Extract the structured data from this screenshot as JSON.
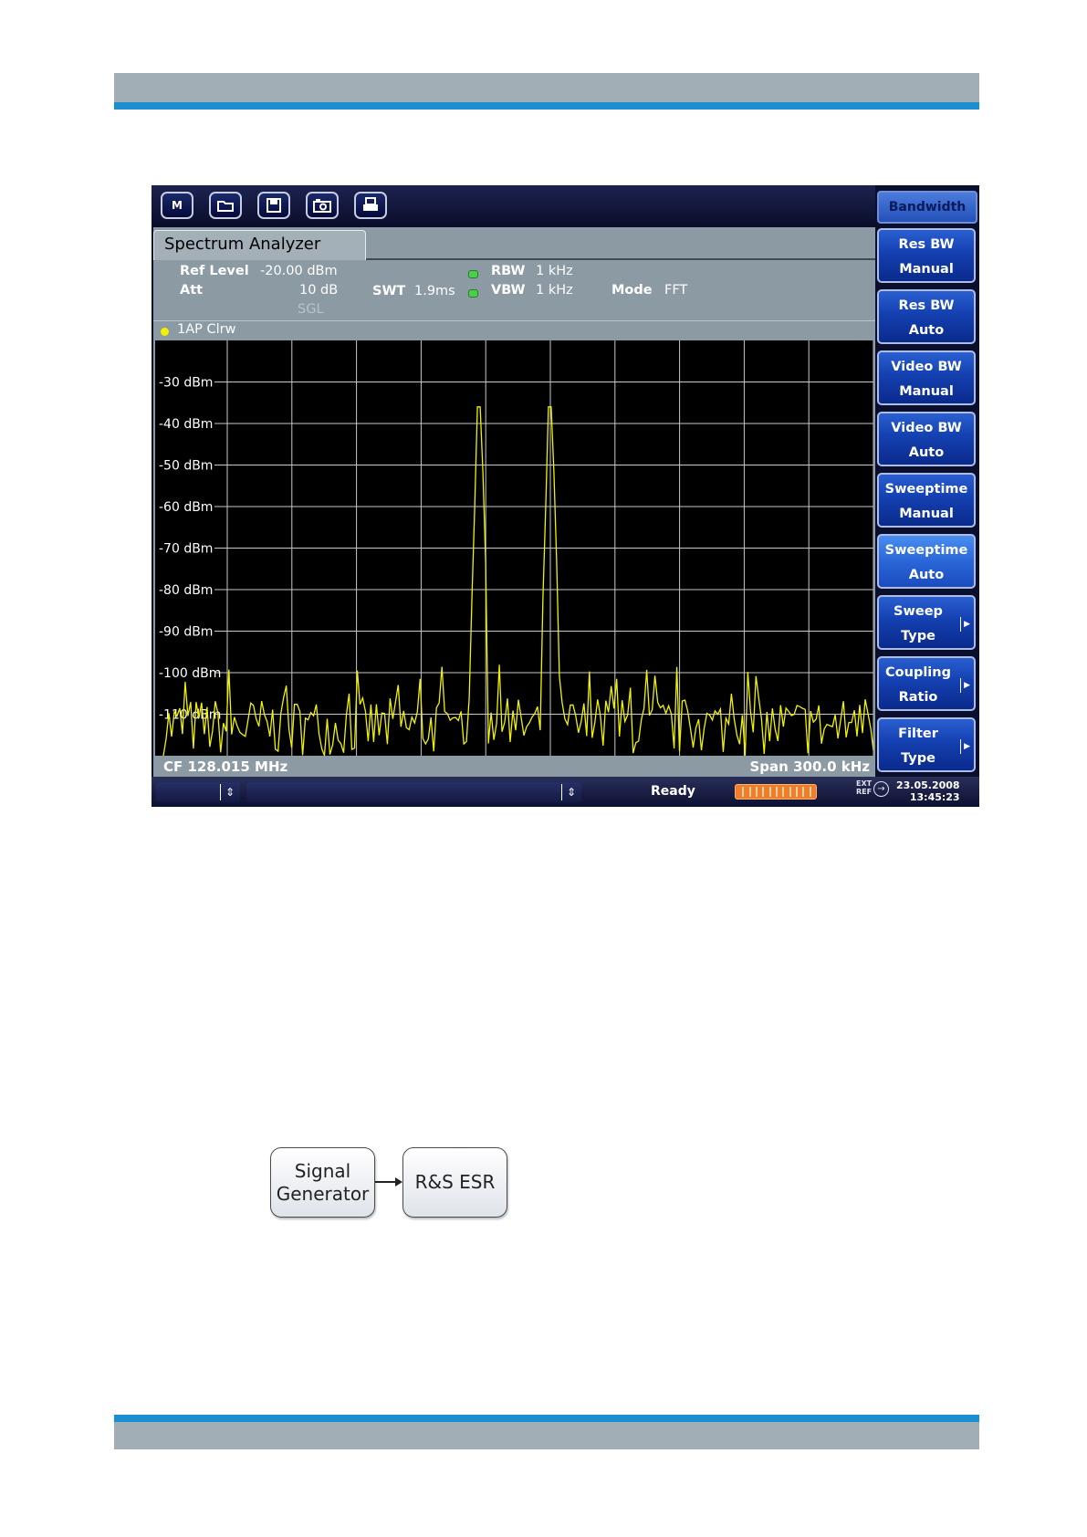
{
  "toolbar": {
    "buttons": [
      {
        "name": "mode-icon",
        "glyph": "M"
      },
      {
        "name": "open-icon",
        "glyph": "📂"
      },
      {
        "name": "save-icon",
        "glyph": "💾"
      },
      {
        "name": "screenshot-icon",
        "glyph": "📷"
      },
      {
        "name": "print-icon",
        "glyph": "🖶"
      }
    ]
  },
  "softkeys": {
    "title": "Bandwidth",
    "keys": [
      {
        "l1": "Res BW",
        "l2": "Manual",
        "active": false,
        "submenu": false
      },
      {
        "l1": "Res BW",
        "l2": "Auto",
        "active": false,
        "submenu": false
      },
      {
        "l1": "Video BW",
        "l2": "Manual",
        "active": false,
        "submenu": false
      },
      {
        "l1": "Video BW",
        "l2": "Auto",
        "active": false,
        "submenu": false
      },
      {
        "l1": "Sweeptime",
        "l2": "Manual",
        "active": false,
        "submenu": false
      },
      {
        "l1": "Sweeptime",
        "l2": "Auto",
        "active": true,
        "submenu": false
      },
      {
        "l1": "Sweep",
        "l2": "Type",
        "active": false,
        "submenu": true
      },
      {
        "l1": "Coupling",
        "l2": "Ratio",
        "active": false,
        "submenu": true
      },
      {
        "l1": "Filter",
        "l2": "Type",
        "active": false,
        "submenu": true
      }
    ]
  },
  "panel": {
    "tab_title": "Spectrum Analyzer",
    "ref_level_label": "Ref Level",
    "ref_level_value": "-20.00 dBm",
    "att_label": "Att",
    "att_value": "10 dB",
    "sgl": "SGL",
    "swt_label": "SWT",
    "swt_value": "1.9ms",
    "rbw_label": "RBW",
    "rbw_value": "1 kHz",
    "vbw_label": "VBW",
    "vbw_value": "1 kHz",
    "mode_label": "Mode",
    "mode_value": "FFT",
    "trace_label": "1AP Clrw",
    "trace_color": "#f2f200"
  },
  "chart_data": {
    "type": "line",
    "ylabels": [
      "-30 dBm",
      "-40 dBm",
      "-50 dBm",
      "-60 dBm",
      "-70 dBm",
      "-80 dBm",
      "-90 dBm",
      "-100 dBm",
      "-110 dBm"
    ],
    "ylim": [
      -120,
      -20
    ],
    "y_ticks": [
      -30,
      -40,
      -50,
      -60,
      -70,
      -80,
      -90,
      -100,
      -110
    ],
    "x_divisions": 10,
    "grid": true,
    "noise_floor_dbm": -112,
    "peaks": [
      {
        "x_fraction": 0.445,
        "level_dbm": -36
      },
      {
        "x_fraction": 0.545,
        "level_dbm": -36
      }
    ],
    "cf": "CF 128.015 MHz",
    "span": "Span 300.0 kHz"
  },
  "status": {
    "ready": "Ready",
    "ext_ref_top": "EXT",
    "ext_ref_bottom": "REF",
    "date": "23.05.2008",
    "time": "13:45:23",
    "spinner": "⇕",
    "progress_segments": 12
  },
  "diagram": {
    "box1": [
      "Signal",
      "Generator"
    ],
    "box2": "R&S ESR"
  }
}
